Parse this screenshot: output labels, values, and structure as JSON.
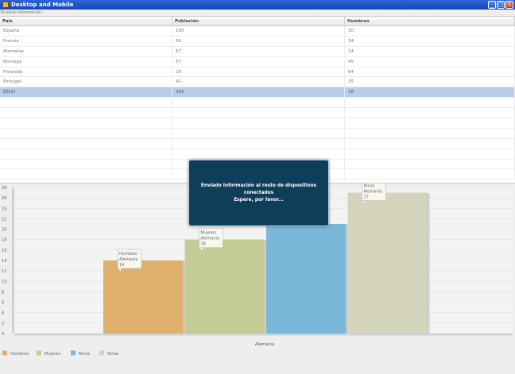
{
  "window": {
    "title": "Desktop and Mobile",
    "minimize_glyph": "_",
    "maximize_glyph": "□",
    "close_glyph": "X"
  },
  "status": "Enviado información...",
  "table": {
    "headers": [
      "País",
      "Población",
      "Hombres"
    ],
    "rows": [
      [
        "España",
        "100",
        "30"
      ],
      [
        "Francia",
        "56",
        "34"
      ],
      [
        "Alemania",
        "67",
        "14"
      ],
      [
        "Noruega",
        "57",
        "45"
      ],
      [
        "Finlandia",
        "29",
        "64"
      ],
      [
        "Portugal",
        "41",
        "25"
      ],
      [
        "EEUU",
        "425",
        "18"
      ]
    ],
    "selected_row": 6
  },
  "chart_data": {
    "type": "bar",
    "categories": [
      "Alemania"
    ],
    "series": [
      {
        "name": "Hombres",
        "values": [
          14
        ],
        "color": "#e0b06d"
      },
      {
        "name": "Mujeres",
        "values": [
          18
        ],
        "color": "#c2cc94"
      },
      {
        "name": "Ninos",
        "values": [
          21
        ],
        "color": "#7ab7d8"
      },
      {
        "name": "Ninas",
        "values": [
          27
        ],
        "color": "#d4d3bb"
      }
    ],
    "xlabel": "Alemania",
    "ylim": [
      0,
      28
    ],
    "yticks": [
      "0",
      "2",
      "4",
      "6",
      "8",
      "10",
      "12",
      "14",
      "16",
      "18",
      "20",
      "22",
      "24",
      "26",
      "28"
    ],
    "tooltips": [
      {
        "series": "Hombres",
        "category": "Alemania",
        "value": "14"
      },
      {
        "series": "Mujeres",
        "category": "Alemania",
        "value": "18"
      },
      {
        "series": "Ninas",
        "category": "Alemania",
        "value": "27"
      }
    ],
    "legend_position": "bottom-left",
    "grid": true
  },
  "dialog": {
    "line1": "Enviado Información al resto de dispositivos conectados",
    "line2": "Espere, por favor..."
  }
}
